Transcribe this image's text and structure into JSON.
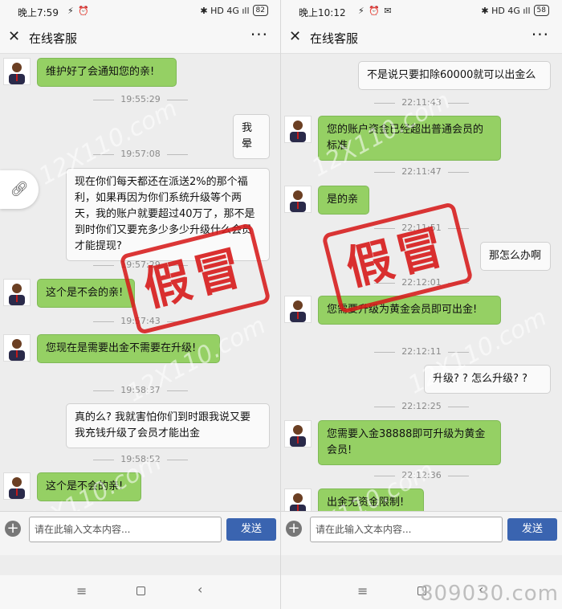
{
  "left": {
    "status": {
      "time": "晚上7:59",
      "icons": "⚡ ⏰",
      "right_icons": "✱ HD 4G ıll",
      "battery": "82"
    },
    "header": {
      "title": "在线客服"
    },
    "messages": [
      {
        "side": "agent",
        "text": "维护好了会通知您的亲!"
      },
      {
        "ts": "19:55:29"
      },
      {
        "side": "user",
        "text": "我晕"
      },
      {
        "ts": "19:57:08"
      },
      {
        "side": "user",
        "text": "现在你们每天都还在派送2%的那个福利，如果再因为你们系统升级等个两天，我的账户就要超过40万了，那不是到时你们又要充多少多少升级什么会员才能提现?"
      },
      {
        "ts": "19:57:29"
      },
      {
        "side": "agent",
        "text": "这个是不会的亲!"
      },
      {
        "ts": "19:57:43"
      },
      {
        "side": "agent",
        "text": "您现在是需要出金不需要在升级!"
      },
      {
        "ts": "19:58:37"
      },
      {
        "side": "user",
        "text": "真的么? 我就害怕你们到时跟我说又要我充钱升级了会员才能出金"
      },
      {
        "ts": "19:58:52"
      },
      {
        "side": "agent",
        "text": "这个是不会的亲!"
      }
    ],
    "input": {
      "placeholder": "请在此输入文本内容...",
      "send": "发送"
    }
  },
  "right": {
    "status": {
      "time": "晚上10:12",
      "icons": "⚡ ⏰ ✉",
      "right_icons": "✱ HD 4G ıll",
      "battery": "58"
    },
    "header": {
      "title": "在线客服"
    },
    "messages": [
      {
        "side": "user",
        "text": "不是说只要扣除60000就可以出金么"
      },
      {
        "ts": "22:11:43"
      },
      {
        "side": "agent",
        "text": "您的账户资金已经超出普通会员的标准"
      },
      {
        "ts": "22:11:47"
      },
      {
        "side": "agent",
        "text": "是的亲"
      },
      {
        "ts": "22:11:51"
      },
      {
        "side": "user",
        "text": "那怎么办啊"
      },
      {
        "ts": "22:12:01"
      },
      {
        "side": "agent",
        "text": "您需要升级为黄金会员即可出金!"
      },
      {
        "ts": "22:12:11"
      },
      {
        "side": "user",
        "text": "升级? ? 怎么升级? ?"
      },
      {
        "ts": "22:12:25"
      },
      {
        "side": "agent",
        "text": "您需要入金38888即可升级为黄金会员!"
      },
      {
        "ts": "22:12:36"
      },
      {
        "side": "agent",
        "text": "出金无资金限制!"
      }
    ],
    "input": {
      "placeholder": "请在此输入文本内容...",
      "send": "发送"
    }
  },
  "stamp_text": "假冒",
  "watermark_text": "12X110.com",
  "corner_watermark": "809030.com",
  "colors": {
    "agent_bubble": "#95d064",
    "user_bubble": "#fafafa",
    "stamp": "#d61a1a",
    "send_button": "#3a64b0"
  }
}
